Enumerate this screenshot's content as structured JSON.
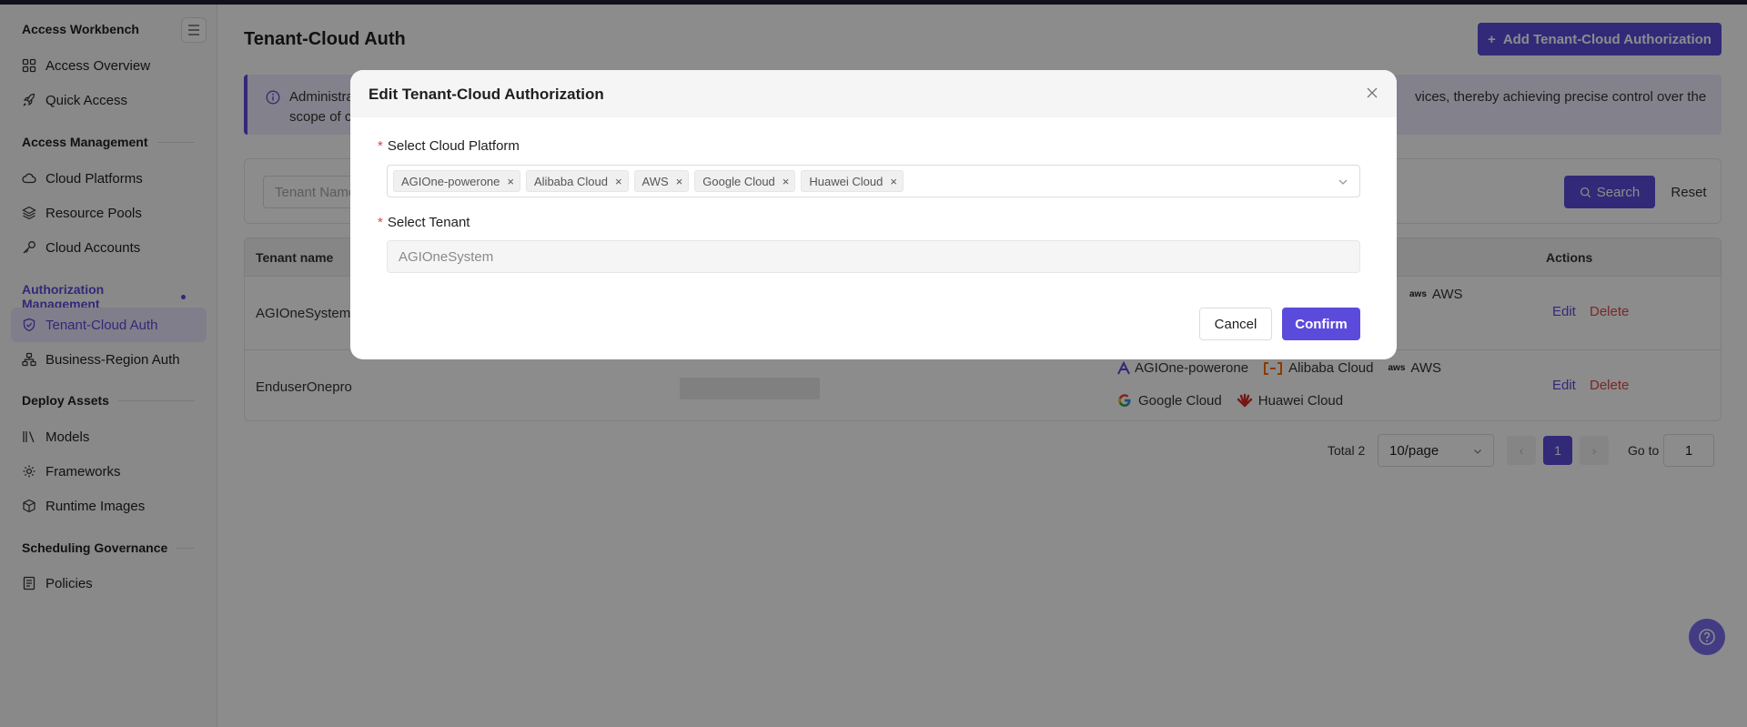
{
  "sidebar": {
    "workbench_title": "Access Workbench",
    "workbench_items": [
      "Access Overview",
      "Quick Access"
    ],
    "access_mgmt_title": "Access Management",
    "access_mgmt_items": [
      "Cloud Platforms",
      "Resource Pools",
      "Cloud Accounts"
    ],
    "auth_mgmt_title": "Authorization Management",
    "auth_mgmt_items": [
      "Tenant-Cloud Auth",
      "Business-Region Auth"
    ],
    "deploy_title": "Deploy Assets",
    "deploy_items": [
      "Models",
      "Frameworks",
      "Runtime Images"
    ],
    "sched_title": "Scheduling Governance",
    "sched_items": [
      "Policies"
    ]
  },
  "header": {
    "title": "Tenant-Cloud Auth",
    "add_button": "Add Tenant-Cloud Authorization"
  },
  "banner": {
    "text_left": "Administra",
    "text_right": "vices, thereby achieving precise control over the",
    "text_line2": "scope of c"
  },
  "filter": {
    "tenant_placeholder": "Tenant Name",
    "search_label": "Search",
    "reset_label": "Reset"
  },
  "table": {
    "col_tenant": "Tenant name",
    "col_actions": "Actions",
    "rows": [
      {
        "tenant": "AGIOneSystem",
        "platforms_visible": [
          "AWS"
        ],
        "edit": "Edit",
        "delete": "Delete"
      },
      {
        "tenant": "EnduserOnepro",
        "platforms_line1": [
          "AGIOne-powerone",
          "Alibaba Cloud",
          "AWS"
        ],
        "platforms_line2": [
          "Google Cloud",
          "Huawei Cloud"
        ],
        "edit": "Edit",
        "delete": "Delete"
      }
    ]
  },
  "pagination": {
    "total": "Total 2",
    "page_size": "10/page",
    "current_page": "1",
    "goto_label": "Go to",
    "goto_value": "1"
  },
  "modal": {
    "title": "Edit Tenant-Cloud Authorization",
    "cloud_label": "Select Cloud Platform",
    "cloud_tags": [
      "AGIOne-powerone",
      "Alibaba Cloud",
      "AWS",
      "Google Cloud",
      "Huawei Cloud"
    ],
    "tenant_label": "Select Tenant",
    "tenant_value": "AGIOneSystem",
    "required_mark": "*",
    "tag_remove": "×",
    "cancel": "Cancel",
    "confirm": "Confirm"
  },
  "colors": {
    "accent": "#5b4bdb",
    "danger": "#e0454a"
  }
}
